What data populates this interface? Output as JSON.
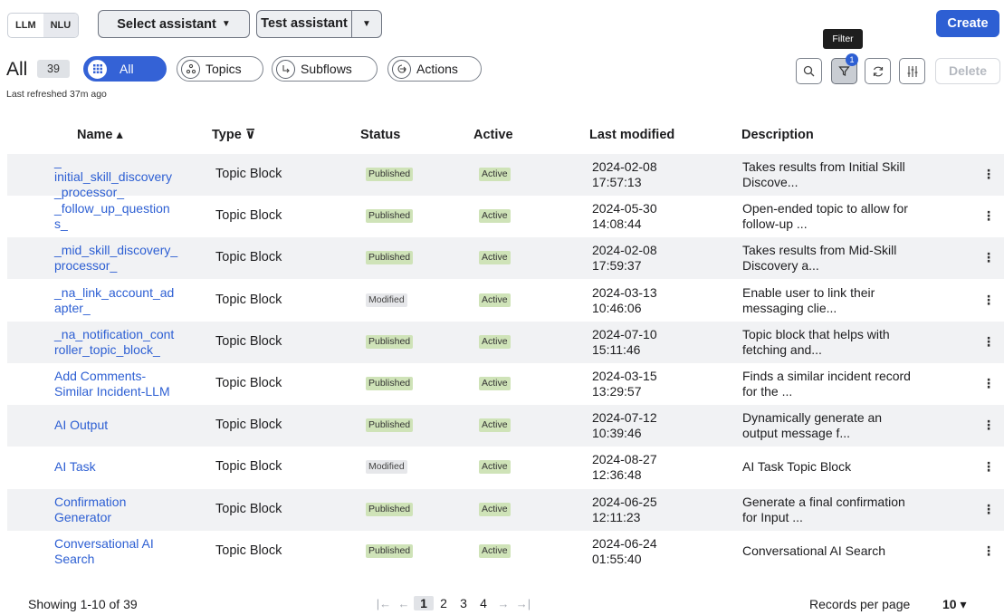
{
  "toolbar": {
    "mode_llm": "LLM",
    "mode_nlu": "NLU",
    "select_assistant": "Select assistant",
    "test_assistant": "Test assistant",
    "create": "Create",
    "delete": "Delete",
    "tooltip": "Filter",
    "filter_badge": "1"
  },
  "filters": {
    "title": "All",
    "count": "39",
    "pills": [
      "All",
      "Topics",
      "Subflows",
      "Actions"
    ],
    "last_refreshed": "Last refreshed 37m ago"
  },
  "table": {
    "headers": {
      "name": "Name ▴",
      "type": "Type ⊽",
      "status": "Status",
      "active": "Active",
      "modified": "Last modified",
      "description": "Description"
    },
    "rows": [
      {
        "name": "_\ninitial_skill_discovery\n_processor_",
        "type": "Topic Block",
        "status": "Published",
        "active": "Active",
        "modified": "2024-02-08\n17:57:13",
        "description": "Takes results from Initial Skill\nDiscove..."
      },
      {
        "name": "_follow_up_question\ns_",
        "type": "Topic Block",
        "status": "Published",
        "active": "Active",
        "modified": "2024-05-30\n14:08:44",
        "description": "Open-ended topic to allow for\nfollow-up ..."
      },
      {
        "name": "_mid_skill_discovery_\nprocessor_",
        "type": "Topic Block",
        "status": "Published",
        "active": "Active",
        "modified": "2024-02-08\n17:59:37",
        "description": "Takes results from Mid-Skill\nDiscovery a..."
      },
      {
        "name": "_na_link_account_ad\napter_",
        "type": "Topic Block",
        "status": "Modified",
        "active": "Active",
        "modified": "2024-03-13\n10:46:06",
        "description": "Enable user to link their\nmessaging clie..."
      },
      {
        "name": "_na_notification_cont\nroller_topic_block_",
        "type": "Topic Block",
        "status": "Published",
        "active": "Active",
        "modified": "2024-07-10\n15:11:46",
        "description": "Topic block that helps with\nfetching and..."
      },
      {
        "name": "Add Comments-\nSimilar Incident-LLM",
        "type": "Topic Block",
        "status": "Published",
        "active": "Active",
        "modified": "2024-03-15\n13:29:57",
        "description": "Finds a similar incident record\nfor the ..."
      },
      {
        "name": "AI Output",
        "type": "Topic Block",
        "status": "Published",
        "active": "Active",
        "modified": "2024-07-12\n10:39:46",
        "description": "Dynamically generate an\noutput message f..."
      },
      {
        "name": "AI Task",
        "type": "Topic Block",
        "status": "Modified",
        "active": "Active",
        "modified": "2024-08-27\n12:36:48",
        "description": "AI Task Topic Block"
      },
      {
        "name": "Confirmation\nGenerator",
        "type": "Topic Block",
        "status": "Published",
        "active": "Active",
        "modified": "2024-06-25\n12:11:23",
        "description": "Generate a final confirmation\nfor Input ..."
      },
      {
        "name": "Conversational AI\nSearch",
        "type": "Topic Block",
        "status": "Published",
        "active": "Active",
        "modified": "2024-06-24\n01:55:40",
        "description": "Conversational AI Search"
      }
    ]
  },
  "footer": {
    "showing": "Showing 1-10 of 39",
    "pages": [
      "1",
      "2",
      "3",
      "4"
    ],
    "current_page": "1",
    "records_label": "Records per page",
    "records_value": "10 ▾"
  },
  "colors": {
    "accent": "#2d5fd3",
    "published": "#cfe3b8",
    "modified": "#e6e7ea"
  }
}
